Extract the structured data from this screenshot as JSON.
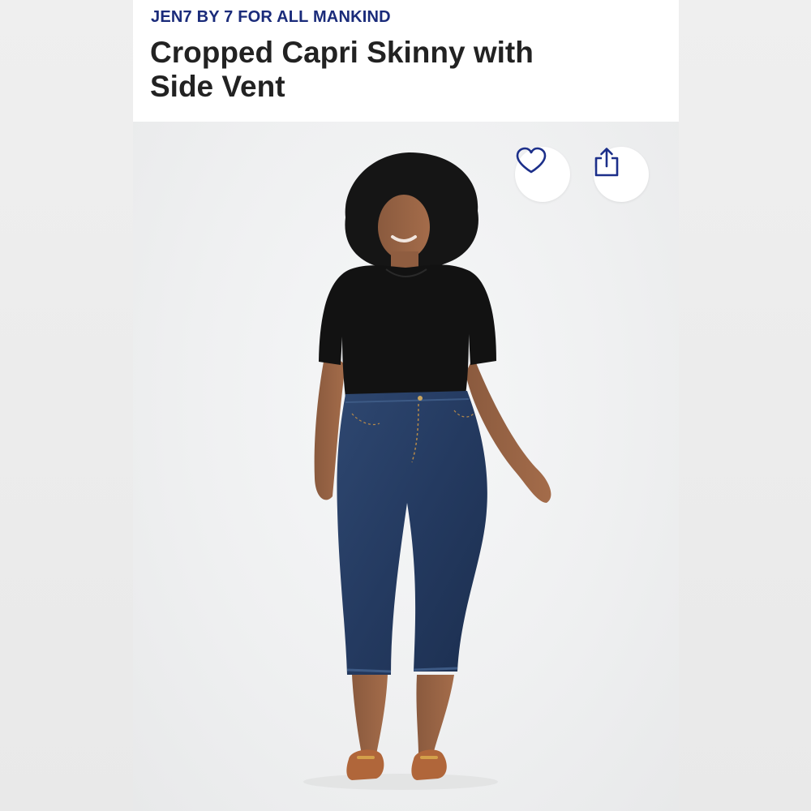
{
  "product": {
    "brand": "JEN7 BY 7 FOR ALL MANKIND",
    "title": "Cropped Capri Skinny with Side Vent"
  },
  "actions": {
    "favorite_icon": "heart-outline-icon",
    "share_icon": "share-upload-icon"
  },
  "colors": {
    "brand_text": "#1a2b7a",
    "title_text": "#222222",
    "button_icon": "#1c2f8a"
  }
}
